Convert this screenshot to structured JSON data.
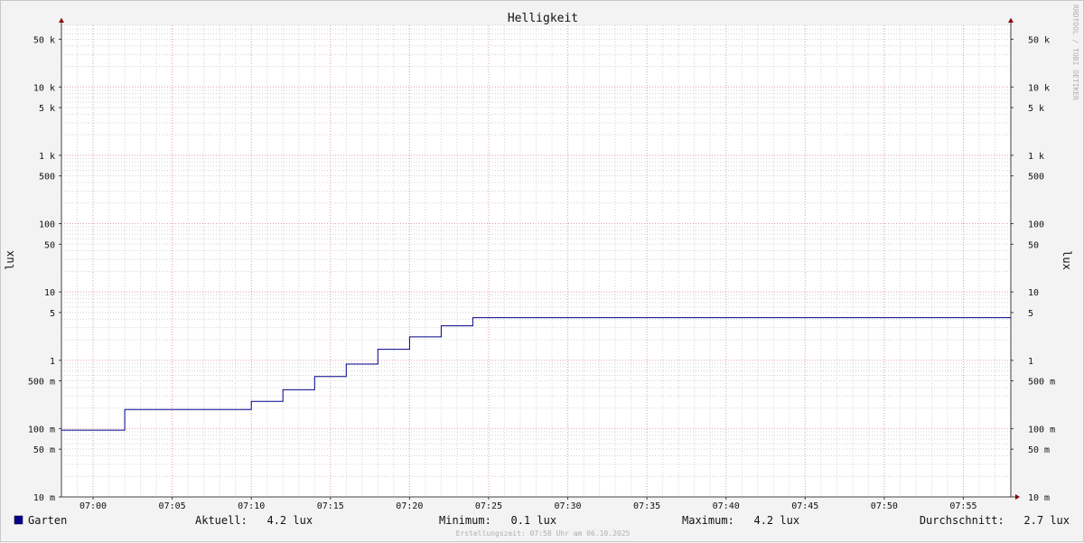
{
  "chart_data": {
    "type": "line",
    "title": "Helligkeit",
    "ylabel": "lux",
    "yscale": "log",
    "ylim": [
      0.01,
      80000
    ],
    "xlim": [
      "06:58",
      "07:58"
    ],
    "grid": true,
    "y_ticks": [
      {
        "value": 50000,
        "label": "50 k"
      },
      {
        "value": 10000,
        "label": "10 k"
      },
      {
        "value": 5000,
        "label": "5 k"
      },
      {
        "value": 1000,
        "label": "1 k"
      },
      {
        "value": 500,
        "label": "500"
      },
      {
        "value": 100,
        "label": "100"
      },
      {
        "value": 50,
        "label": "50"
      },
      {
        "value": 10,
        "label": "10"
      },
      {
        "value": 5,
        "label": "5"
      },
      {
        "value": 1,
        "label": "1"
      },
      {
        "value": 0.5,
        "label": "500 m"
      },
      {
        "value": 0.1,
        "label": "100 m"
      },
      {
        "value": 0.05,
        "label": "50 m"
      },
      {
        "value": 0.01,
        "label": "10 m"
      }
    ],
    "x_ticks": [
      "07:00",
      "07:05",
      "07:10",
      "07:15",
      "07:20",
      "07:25",
      "07:30",
      "07:35",
      "07:40",
      "07:45",
      "07:50",
      "07:55"
    ],
    "series": [
      {
        "name": "Garten",
        "color": "#00008b",
        "points": [
          [
            "06:58",
            0.095
          ],
          [
            "07:02",
            0.095
          ],
          [
            "07:02",
            0.19
          ],
          [
            "07:10",
            0.19
          ],
          [
            "07:10",
            0.25
          ],
          [
            "07:12",
            0.25
          ],
          [
            "07:12",
            0.37
          ],
          [
            "07:14",
            0.37
          ],
          [
            "07:14",
            0.58
          ],
          [
            "07:16",
            0.58
          ],
          [
            "07:16",
            0.88
          ],
          [
            "07:18",
            0.88
          ],
          [
            "07:18",
            1.45
          ],
          [
            "07:20",
            1.45
          ],
          [
            "07:20",
            2.2
          ],
          [
            "07:22",
            2.2
          ],
          [
            "07:22",
            3.2
          ],
          [
            "07:24",
            3.2
          ],
          [
            "07:24",
            4.2
          ],
          [
            "07:58",
            4.2
          ]
        ]
      }
    ]
  },
  "legend": {
    "series_name": "Garten",
    "swatch_color": "#00008b",
    "stats": {
      "current": "Aktuell:   4.2 lux",
      "minimum": "Minimum:   0.1 lux",
      "maximum": "Maximum:   4.2 lux",
      "average": "Durchschnitt:   2.7 lux"
    }
  },
  "footer": "Erstellungszeit: 07:58 Uhr am 06.10.2025",
  "watermark": "RRDTOOL / TOBI OETIKER",
  "colors": {
    "major_grid": "#e0a0a0",
    "minor_grid": "#d4d4d4",
    "axis": "#404040",
    "arrow": "#8b0000"
  }
}
